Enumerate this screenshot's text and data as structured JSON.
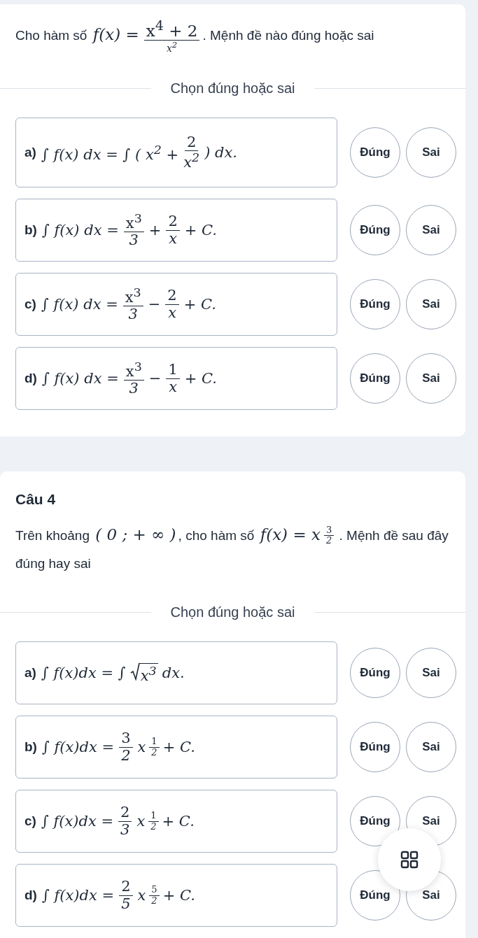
{
  "questions": [
    {
      "intro": [
        {
          "kind": "text",
          "s": "Cho hàm số "
        },
        {
          "kind": "math",
          "s": "f(x) ="
        },
        {
          "kind": "frac",
          "num": "x$^{4}$ + 2",
          "den": "x$^{2}$"
        },
        {
          "kind": "text",
          "s": ". Mệnh đề nào đúng hoặc sai"
        }
      ],
      "divider": "Chọn đúng hoặc sai",
      "statements": [
        {
          "label": "a)",
          "parts": [
            {
              "kind": "math",
              "s": "∫ f(x) dx = ∫ ( x$^{2}$ +"
            },
            {
              "kind": "frac",
              "num": "2",
              "den": "x$^{2}$"
            },
            {
              "kind": "math",
              "s": ") dx."
            }
          ],
          "options": [
            {
              "label": "Đúng",
              "selected": false
            },
            {
              "label": "Sai",
              "selected": false
            }
          ]
        },
        {
          "label": "b)",
          "parts": [
            {
              "kind": "math",
              "s": "∫ f(x) dx ="
            },
            {
              "kind": "frac",
              "num": "x$^{3}$",
              "den": "3"
            },
            {
              "kind": "math",
              "s": "+"
            },
            {
              "kind": "frac",
              "num": "2",
              "den": "x"
            },
            {
              "kind": "math",
              "s": "+ C."
            }
          ],
          "options": [
            {
              "label": "Đúng",
              "selected": false
            },
            {
              "label": "Sai",
              "selected": false
            }
          ]
        },
        {
          "label": "c)",
          "parts": [
            {
              "kind": "math",
              "s": "∫ f(x) dx ="
            },
            {
              "kind": "frac",
              "num": "x$^{3}$",
              "den": "3"
            },
            {
              "kind": "math",
              "s": "−"
            },
            {
              "kind": "frac",
              "num": "2",
              "den": "x"
            },
            {
              "kind": "math",
              "s": "+ C."
            }
          ],
          "options": [
            {
              "label": "Đúng",
              "selected": false
            },
            {
              "label": "Sai",
              "selected": false
            }
          ]
        },
        {
          "label": "d)",
          "parts": [
            {
              "kind": "math",
              "s": "∫ f(x) dx ="
            },
            {
              "kind": "frac",
              "num": "x$^{3}$",
              "den": "3"
            },
            {
              "kind": "math",
              "s": "−"
            },
            {
              "kind": "frac",
              "num": "1",
              "den": "x"
            },
            {
              "kind": "math",
              "s": "+ C."
            }
          ],
          "options": [
            {
              "label": "Đúng",
              "selected": false
            },
            {
              "label": "Sai",
              "selected": false
            }
          ]
        }
      ]
    },
    {
      "heading": "Câu 4",
      "intro": [
        {
          "kind": "text",
          "s": "Trên khoảng "
        },
        {
          "kind": "math",
          "s": "( 0 ; + ∞ )"
        },
        {
          "kind": "text",
          "s": ", cho hàm số "
        },
        {
          "kind": "math",
          "s": "f(x) = x"
        },
        {
          "kind": "supfrac",
          "num": "3",
          "den": "2"
        },
        {
          "kind": "text",
          "s": " . Mệnh đề sau đây đúng hay sai"
        }
      ],
      "divider": "Chọn đúng hoặc sai",
      "statements": [
        {
          "label": "a)",
          "parts": [
            {
              "kind": "math",
              "s": "∫ f(x)dx = ∫"
            },
            {
              "kind": "sqrt",
              "s": "x$^{3}$"
            },
            {
              "kind": "math",
              "s": "dx."
            }
          ],
          "options": [
            {
              "label": "Đúng",
              "selected": false
            },
            {
              "label": "Sai",
              "selected": false
            }
          ]
        },
        {
          "label": "b)",
          "parts": [
            {
              "kind": "math",
              "s": "∫ f(x)dx ="
            },
            {
              "kind": "frac",
              "num": "3",
              "den": "2"
            },
            {
              "kind": "math",
              "s": "x"
            },
            {
              "kind": "supfrac",
              "num": "1",
              "den": "2"
            },
            {
              "kind": "math",
              "s": "+ C."
            }
          ],
          "options": [
            {
              "label": "Đúng",
              "selected": false
            },
            {
              "label": "Sai",
              "selected": false
            }
          ]
        },
        {
          "label": "c)",
          "parts": [
            {
              "kind": "math",
              "s": "∫ f(x)dx ="
            },
            {
              "kind": "frac",
              "num": "2",
              "den": "3"
            },
            {
              "kind": "math",
              "s": "x"
            },
            {
              "kind": "supfrac",
              "num": "1",
              "den": "2"
            },
            {
              "kind": "math",
              "s": "+ C."
            }
          ],
          "options": [
            {
              "label": "Đúng",
              "selected": false
            },
            {
              "label": "Sai",
              "selected": false
            }
          ]
        },
        {
          "label": "d)",
          "parts": [
            {
              "kind": "math",
              "s": "∫ f(x)dx ="
            },
            {
              "kind": "frac",
              "num": "2",
              "den": "5"
            },
            {
              "kind": "math",
              "s": "x"
            },
            {
              "kind": "supfrac",
              "num": "5",
              "den": "2"
            },
            {
              "kind": "math",
              "s": "+ C."
            }
          ],
          "options": [
            {
              "label": "Đúng",
              "selected": false
            },
            {
              "label": "Sai",
              "selected": false
            }
          ]
        }
      ]
    }
  ]
}
